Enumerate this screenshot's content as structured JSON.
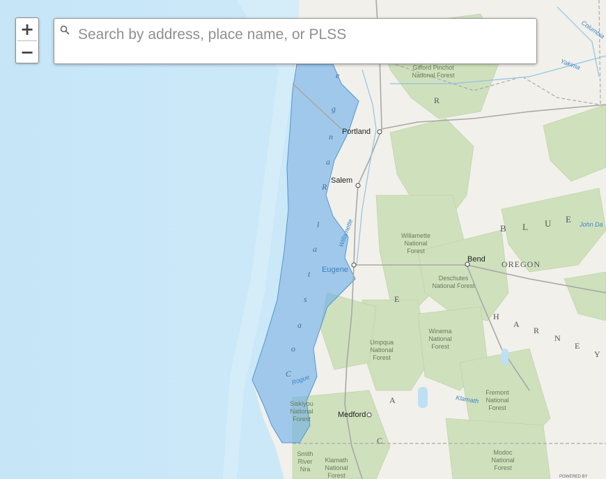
{
  "zoom": {
    "in_label": "+",
    "out_label": "−"
  },
  "search": {
    "placeholder": "Search by address, place name, or PLSS",
    "icon": "search-icon"
  },
  "cities": {
    "portland": "Portland",
    "salem": "Salem",
    "eugene": "Eugene",
    "bend": "Bend",
    "medford": "Medford"
  },
  "forests": {
    "gifford_1": "Gifford Pinchot",
    "gifford_2": "National Forest",
    "willamette_1": "Willamette",
    "willamette_2": "National",
    "willamette_3": "Forest",
    "deschutes_1": "Deschutes",
    "deschutes_2": "National Forest",
    "umpqua_1": "Umpqua",
    "umpqua_2": "National",
    "umpqua_3": "Forest",
    "winema_1": "Winema",
    "winema_2": "National",
    "winema_3": "Forest",
    "fremont_1": "Fremont",
    "fremont_2": "National",
    "fremont_3": "Forest",
    "siskiyou_1": "Siskiyou",
    "siskiyou_2": "National",
    "siskiyou_3": "Forest",
    "smith_1": "Smith",
    "smith_2": "River",
    "smith_3": "Nra",
    "klamath_1": "Klamath",
    "klamath_2": "National",
    "klamath_3": "Forest",
    "modoc_1": "Modoc",
    "modoc_2": "National",
    "modoc_3": "Forest"
  },
  "regions": {
    "oregon": "OREGON",
    "blue": [
      "B",
      "L",
      "U",
      "E"
    ],
    "harney": [
      "H",
      "A",
      "R",
      "N",
      "E",
      "Y"
    ],
    "coast_range": [
      "C",
      "o",
      "a",
      "s",
      "t",
      "a",
      "l",
      "R",
      "a",
      "n",
      "g",
      "e"
    ],
    "cascade": [
      "C",
      "A",
      "E",
      "R"
    ]
  },
  "water": {
    "willamette": "Willamette",
    "columbia": "Columbia",
    "yakima": "Yakima",
    "john_day": "John Da",
    "klamath_river": "Klamath",
    "rogue": "Rogue"
  },
  "partial": {
    "na": "na"
  },
  "attribution": "POWERED BY",
  "colors": {
    "ocean": "#cfe9f7",
    "land": "#f1f0ea",
    "forest": "#cfe0bd",
    "highlight": "#6aaee9"
  }
}
